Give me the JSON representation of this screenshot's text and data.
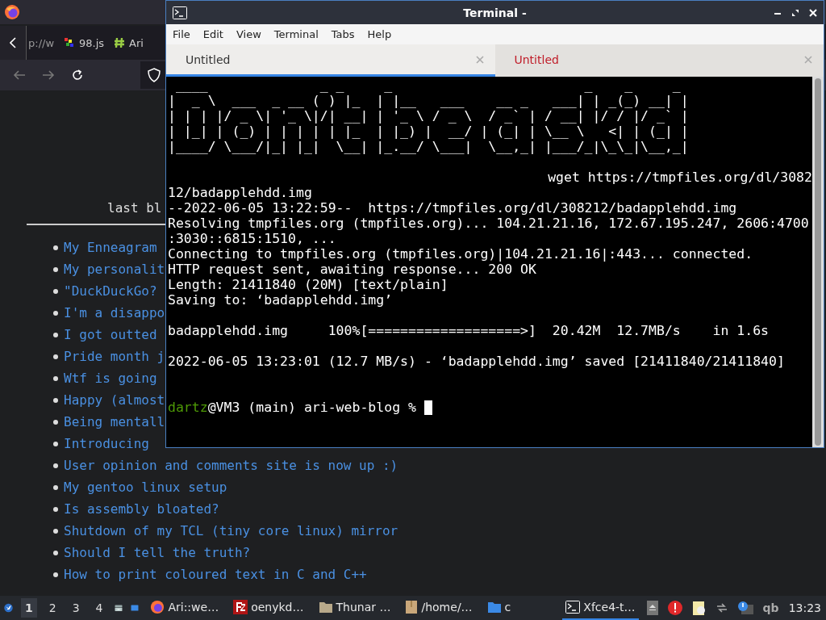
{
  "browser": {
    "tabs": [
      {
        "label": "p://w",
        "kind": "plain"
      },
      {
        "label": "98.js",
        "kind": "pixels"
      },
      {
        "label": "Ari",
        "kind": "hash"
      }
    ],
    "page": {
      "heading": "last bl",
      "posts": [
        "My Enneagram",
        "My personalit",
        "\"DuckDuckGo?",
        "I'm a disappo",
        "I got outted",
        "Pride month j",
        "Wtf is going",
        "Happy (almost",
        "Being mentall",
        "Introducing",
        "User opinion and comments site is now up :)",
        "My gentoo linux setup",
        "Is assembly bloated?",
        "Shutdown of my TCL (tiny core linux) mirror",
        "Should I tell the truth?",
        "How to print coloured text in C and C++"
      ]
    }
  },
  "terminal": {
    "title": "Terminal -",
    "menu": [
      "File",
      "Edit",
      "View",
      "Terminal",
      "Tabs",
      "Help"
    ],
    "tabs": [
      {
        "label": "Untitled",
        "selected": true,
        "activity": false
      },
      {
        "label": "Untitled",
        "selected": false,
        "activity": true
      }
    ],
    "ascii_art": [
      " ____              _ _     _                        _    _     _ ",
      "|  _ \\  ___  _ __ ( ) |_  | |__   ___    __ _   ___| | _(_) __| |",
      "| | | |/ _ \\| '_ \\|/| __| | '_ \\ / _ \\  / _` | / __| |/ / |/ _` |",
      "| |_| | (_) | | | | | |_  | |_) |  __/ | (_| | \\__ \\   <| | (_| |",
      "|____/ \\___/|_| |_|  \\__| |_.__/ \\___|  \\__,_| |___/_|\\_\\_|\\__,_|"
    ],
    "lines": [
      {
        "kind": "blank"
      },
      {
        "kind": "right",
        "text": "wget https://tmpfiles.org/dl/3082"
      },
      {
        "kind": "plain",
        "text": "12/badapplehdd.img"
      },
      {
        "kind": "plain",
        "text": "--2022-06-05 13:22:59--  https://tmpfiles.org/dl/308212/badapplehdd.img"
      },
      {
        "kind": "plain",
        "text": "Resolving tmpfiles.org (tmpfiles.org)... 104.21.21.16, 172.67.195.247, 2606:4700"
      },
      {
        "kind": "plain",
        "text": ":3030::6815:1510, ..."
      },
      {
        "kind": "plain",
        "text": "Connecting to tmpfiles.org (tmpfiles.org)|104.21.21.16|:443... connected."
      },
      {
        "kind": "plain",
        "text": "HTTP request sent, awaiting response... 200 OK"
      },
      {
        "kind": "plain",
        "text": "Length: 21411840 (20M) [text/plain]"
      },
      {
        "kind": "plain",
        "text": "Saving to: ‘badapplehdd.img’"
      },
      {
        "kind": "blank"
      },
      {
        "kind": "plain",
        "text": "badapplehdd.img     100%[===================>]  20.42M  12.7MB/s    in 1.6s"
      },
      {
        "kind": "blank"
      },
      {
        "kind": "plain",
        "text": "2022-06-05 13:23:01 (12.7 MB/s) - ‘badapplehdd.img’ saved [21411840/21411840]"
      },
      {
        "kind": "blank"
      },
      {
        "kind": "blank"
      },
      {
        "kind": "prompt",
        "user": "dartz",
        "text": "@VM3 (main) ari-web-blog %",
        "cursor": true
      }
    ]
  },
  "taskbar": {
    "workspaces": [
      {
        "label": "1",
        "selected": true
      },
      {
        "label": "2",
        "selected": false
      },
      {
        "label": "3",
        "selected": false
      },
      {
        "label": "4",
        "selected": false
      }
    ],
    "tasks": [
      {
        "label": "Ari::we…",
        "kind": "firefox",
        "selected": false
      },
      {
        "label": "oenykd…",
        "kind": "filezilla",
        "selected": false
      },
      {
        "label": "Thunar …",
        "kind": "folder",
        "selected": false
      },
      {
        "label": "/home/…",
        "kind": "box",
        "selected": false
      },
      {
        "label": "c",
        "kind": "bluefolder",
        "selected": false
      },
      {
        "label": "Xfce4-t…",
        "kind": "terminal",
        "selected": true
      }
    ],
    "tray_text": "qb",
    "clock": "13:23"
  }
}
